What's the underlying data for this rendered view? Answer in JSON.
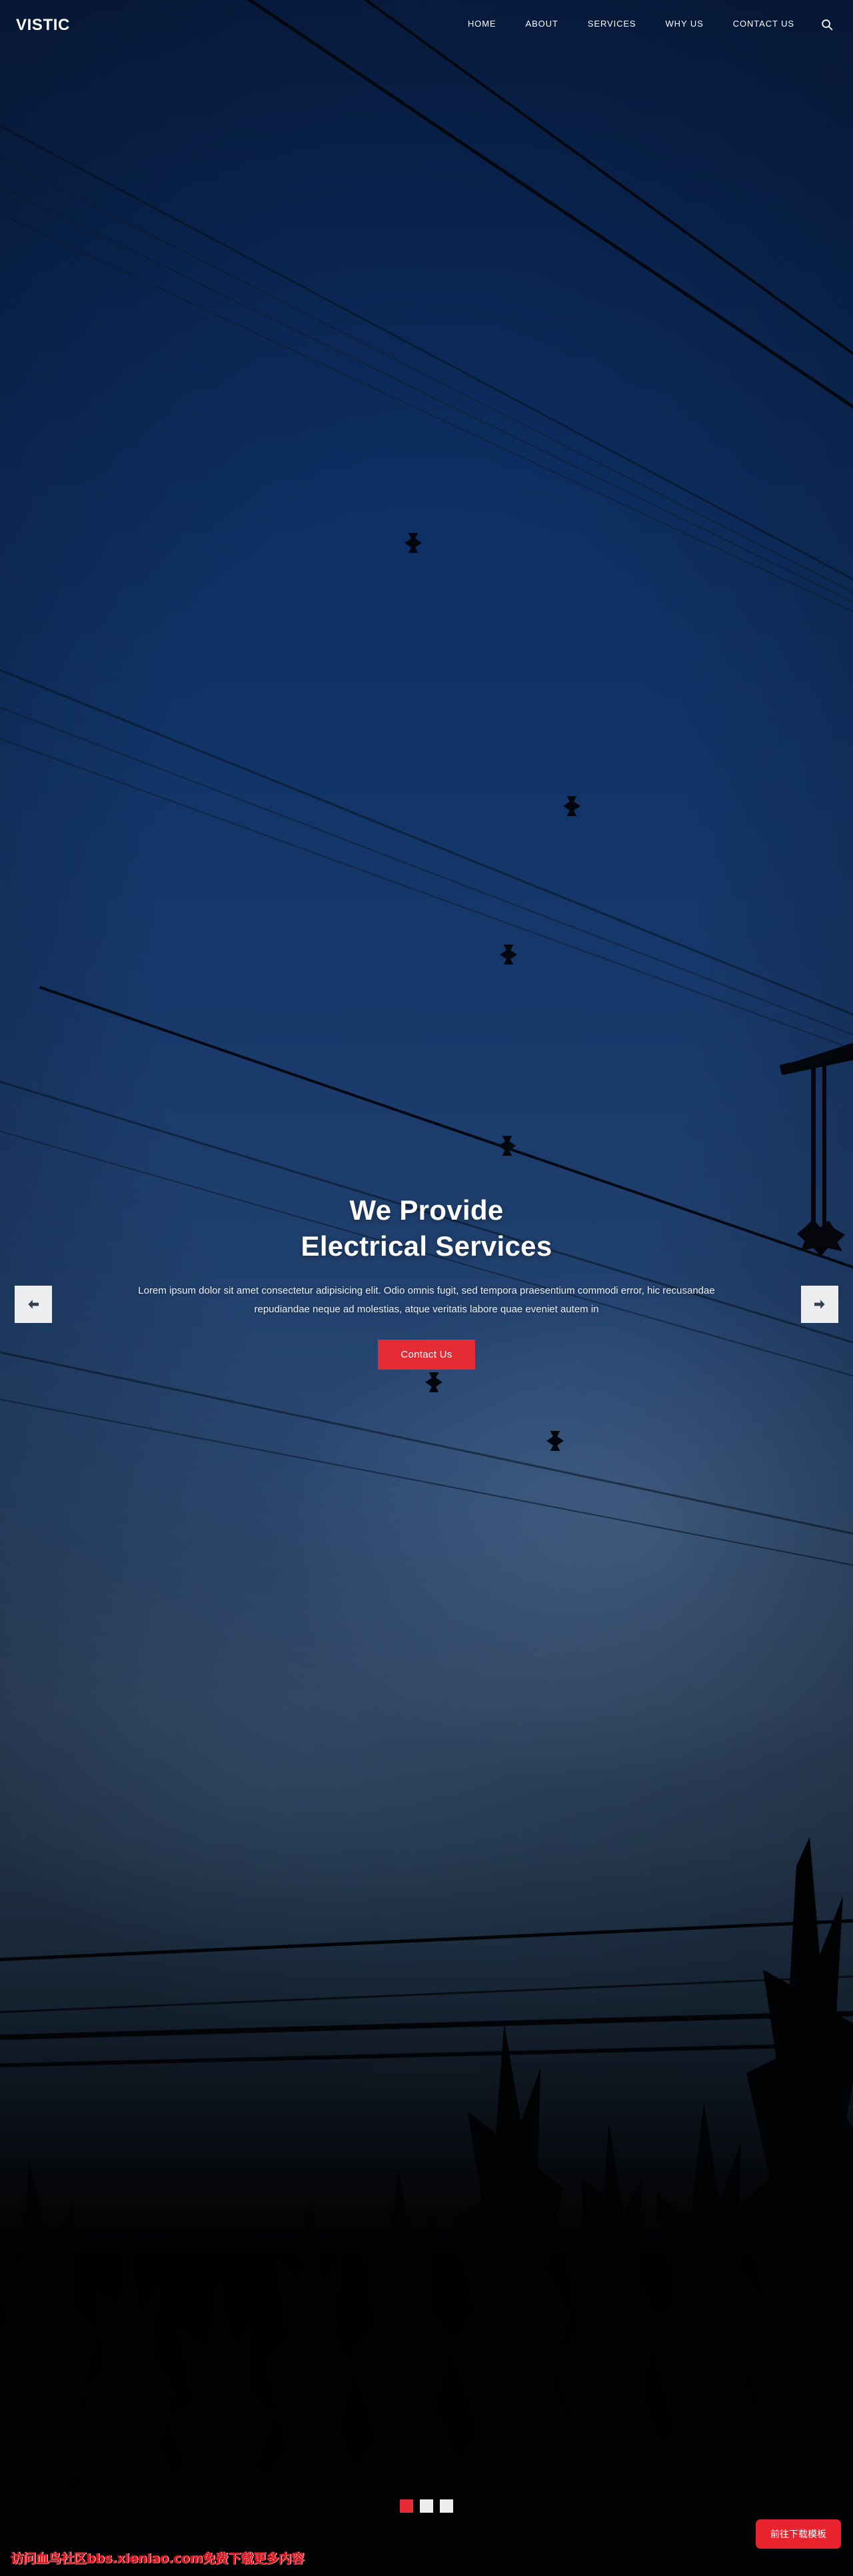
{
  "site": {
    "brand": "VISTIC"
  },
  "header": {
    "nav_items": [
      {
        "label": "HOME"
      },
      {
        "label": "ABOUT"
      },
      {
        "label": "SERVICES"
      },
      {
        "label": "WHY US"
      },
      {
        "label": "CONTACT US"
      }
    ],
    "search_icon": "search-icon"
  },
  "hero": {
    "title_line1": "We Provide",
    "title_line2": "Electrical Services",
    "description": "Lorem ipsum dolor sit amet consectetur adipisicing elit. Odio omnis fugit, sed tempora praesentium commodi error, hic recusandae repudiandae neque ad molestias, atque veritatis labore quae eveniet autem in",
    "cta_label": "Contact Us",
    "prev_icon": "arrow-left-icon",
    "next_icon": "arrow-right-icon",
    "slides_total": 3,
    "active_slide": 1
  },
  "overlay": {
    "watermark_text": "访问血鸟社区bbs.xieniao.com免费下载更多内容",
    "download_label": "前往下载模板"
  },
  "colors": {
    "accent_red": "#e52b34",
    "badge_red": "#e8232d",
    "sky_top": "#0a2350",
    "sky_mid": "#374f70",
    "sky_bottom": "#000000",
    "control_light": "#eceef0",
    "text_white": "#ffffff",
    "watermark_red": "#e8121d"
  }
}
